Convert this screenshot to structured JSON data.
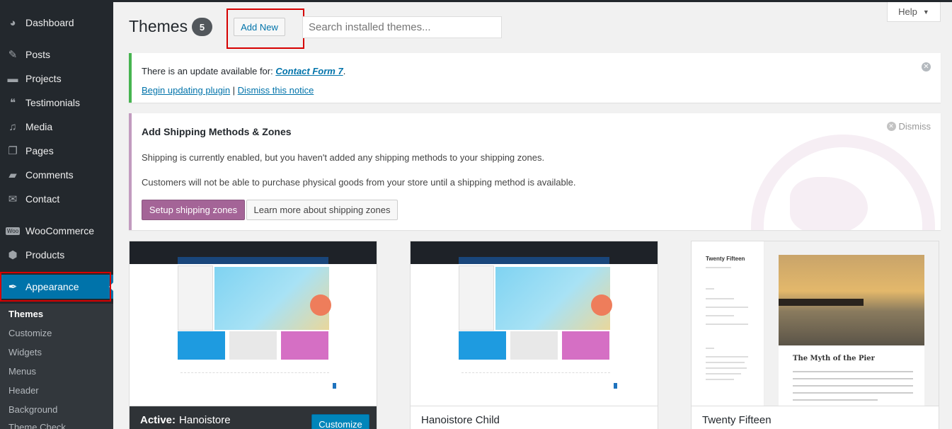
{
  "sidebar": {
    "items": [
      {
        "label": "Dashboard",
        "icon": "dashboard-icon"
      },
      {
        "label": "Posts",
        "icon": "pin-icon"
      },
      {
        "label": "Projects",
        "icon": "folder-icon"
      },
      {
        "label": "Testimonials",
        "icon": "quote-icon"
      },
      {
        "label": "Media",
        "icon": "media-icon"
      },
      {
        "label": "Pages",
        "icon": "pages-icon"
      },
      {
        "label": "Comments",
        "icon": "comment-icon"
      },
      {
        "label": "Contact",
        "icon": "mail-icon"
      },
      {
        "label": "WooCommerce",
        "icon": "woo-icon"
      },
      {
        "label": "Products",
        "icon": "box-icon"
      },
      {
        "label": "Appearance",
        "icon": "brush-icon"
      }
    ],
    "submenu": [
      "Themes",
      "Customize",
      "Widgets",
      "Menus",
      "Header",
      "Background",
      "Theme Check"
    ],
    "woo_icon_text": "Woo"
  },
  "header": {
    "title": "Themes",
    "count": "5",
    "add_new": "Add New",
    "search_placeholder": "Search installed themes...",
    "help": "Help"
  },
  "notice_update": {
    "text": "There is an update available for: ",
    "plugin": "Contact Form 7",
    "period": ".",
    "begin": "Begin updating plugin",
    "separator": " | ",
    "dismiss": "Dismiss this notice"
  },
  "notice_shipping": {
    "title": "Add Shipping Methods & Zones",
    "p1": "Shipping is currently enabled, but you haven't added any shipping methods to your shipping zones.",
    "p2": "Customers will not be able to purchase physical goods from your store until a shipping method is available.",
    "setup": "Setup shipping zones",
    "learn": "Learn more about shipping zones",
    "dismiss": "Dismiss"
  },
  "themes": [
    {
      "name": "Hanoistore",
      "active_label": "Active:",
      "customize": "Customize"
    },
    {
      "name": "Hanoistore Child"
    },
    {
      "name": "Twenty Fifteen",
      "preview_site_title": "Twenty Fifteen",
      "preview_post_title": "The Myth of the Pier"
    }
  ],
  "colors": {
    "accent": "#0073aa",
    "sidebar": "#23282d",
    "woo": "#a46497",
    "success": "#46b450",
    "highlight": "#d60000"
  }
}
